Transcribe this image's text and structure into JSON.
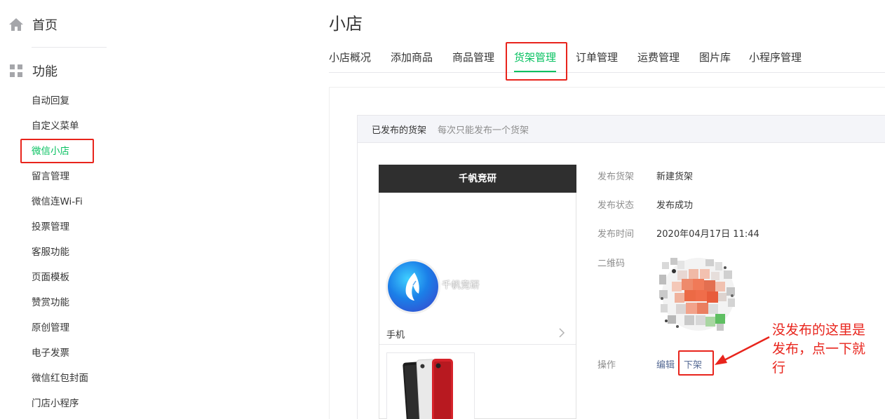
{
  "sidebar": {
    "home_label": "首页",
    "section_label": "功能",
    "items": [
      {
        "label": "自动回复"
      },
      {
        "label": "自定义菜单"
      },
      {
        "label": "微信小店"
      },
      {
        "label": "留言管理"
      },
      {
        "label": "微信连Wi-Fi"
      },
      {
        "label": "投票管理"
      },
      {
        "label": "客服功能"
      },
      {
        "label": "页面模板"
      },
      {
        "label": "赞赏功能"
      },
      {
        "label": "原创管理"
      },
      {
        "label": "电子发票"
      },
      {
        "label": "微信红包封面"
      },
      {
        "label": "门店小程序"
      }
    ],
    "active_item": "微信小店"
  },
  "main": {
    "title": "小店",
    "tabs": [
      {
        "label": "小店概况"
      },
      {
        "label": "添加商品"
      },
      {
        "label": "商品管理"
      },
      {
        "label": "货架管理"
      },
      {
        "label": "订单管理"
      },
      {
        "label": "运费管理"
      },
      {
        "label": "图片库"
      },
      {
        "label": "小程序管理"
      }
    ],
    "active_tab": "货架管理"
  },
  "panel": {
    "heading": "已发布的货架",
    "hint": "每次只能发布一个货架",
    "preview": {
      "bar_title": "千帆竞研",
      "shop_name": "千帆竞研",
      "category_label": "手机"
    },
    "info": {
      "shelf_label": "发布货架",
      "shelf_value": "新建货架",
      "status_label": "发布状态",
      "status_value": "发布成功",
      "time_label": "发布时间",
      "time_value": "2020年04月17日 11:44",
      "qr_label": "二维码",
      "ops_label": "操作",
      "edit_link": "编辑",
      "unpublish_link": "下架"
    }
  },
  "annotation": {
    "text": "没发布的这里是发布，点一下就行"
  },
  "colors": {
    "accent": "#07c160",
    "highlight": "#e8241c",
    "link": "#576b95"
  }
}
